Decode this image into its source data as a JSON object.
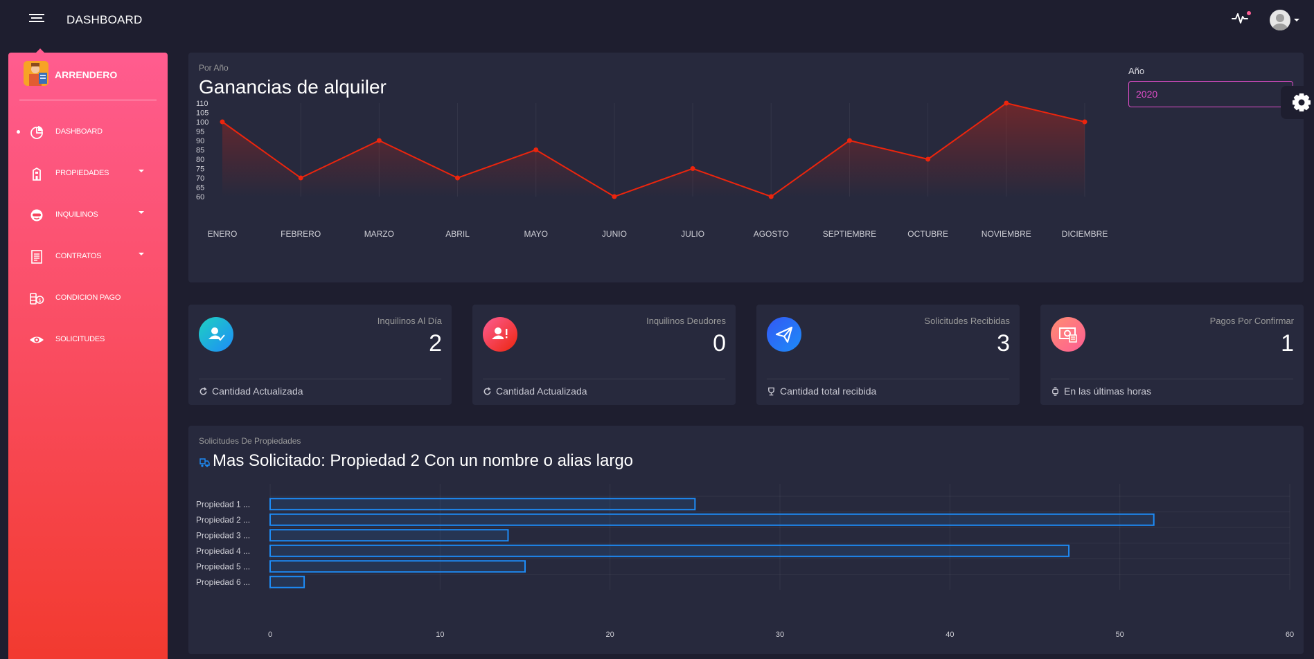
{
  "header": {
    "title": "DASHBOARD"
  },
  "sidebar": {
    "brand": "ARRENDERO",
    "items": [
      {
        "label": "DASHBOARD",
        "icon": "chart-pie-icon",
        "active": true,
        "has_dropdown": false
      },
      {
        "label": "PROPIEDADES",
        "icon": "building-icon",
        "active": false,
        "has_dropdown": true
      },
      {
        "label": "INQUILINOS",
        "icon": "user-mask-icon",
        "active": false,
        "has_dropdown": true
      },
      {
        "label": "CONTRATOS",
        "icon": "document-icon",
        "active": false,
        "has_dropdown": true
      },
      {
        "label": "CONDICION PAGO",
        "icon": "money-stack-icon",
        "active": false,
        "has_dropdown": false
      },
      {
        "label": "SOLICITUDES",
        "icon": "eye-icon",
        "active": false,
        "has_dropdown": false
      }
    ]
  },
  "earnings": {
    "category": "Por Año",
    "title": "Ganancias de alquiler",
    "year_label": "Año",
    "year_selected": "2020"
  },
  "stats": [
    {
      "label": "Inquilinos Al Día",
      "value": "2",
      "footer": "Cantidad Actualizada",
      "icon": "user-check-icon",
      "footer_icon": "refresh-icon",
      "color_from": "#1fd1c1",
      "color_to": "#1d8cf8"
    },
    {
      "label": "Inquilinos Deudores",
      "value": "0",
      "footer": "Cantidad Actualizada",
      "icon": "user-alert-icon",
      "footer_icon": "refresh-icon",
      "color_from": "#fd5d93",
      "color_to": "#ec250d"
    },
    {
      "label": "Solicitudes Recibidas",
      "value": "3",
      "footer": "Cantidad total recibida",
      "icon": "paper-plane-icon",
      "footer_icon": "trophy-icon",
      "color_from": "#3358f4",
      "color_to": "#1d8cf8"
    },
    {
      "label": "Pagos Por Confirmar",
      "value": "1",
      "footer": "En las últimas horas",
      "icon": "money-icon",
      "footer_icon": "watch-icon",
      "color_from": "#ff8d72",
      "color_to": "#fd5d93"
    }
  ],
  "requests": {
    "category": "Solicitudes De Propiedades",
    "title": "Mas Solicitado: Propiedad 2 Con un nombre o alias largo"
  },
  "chart_data": [
    {
      "type": "area",
      "categories": [
        "ENERO",
        "FEBRERO",
        "MARZO",
        "ABRIL",
        "MAYO",
        "JUNIO",
        "JULIO",
        "AGOSTO",
        "SEPTIEMBRE",
        "OCTUBRE",
        "NOVIEMBRE",
        "DICIEMBRE"
      ],
      "values": [
        100,
        70,
        90,
        70,
        85,
        60,
        75,
        60,
        90,
        80,
        110,
        100
      ],
      "yticks": [
        60,
        65,
        70,
        75,
        80,
        85,
        90,
        95,
        100,
        105,
        110
      ],
      "ylim": [
        60,
        110
      ],
      "color": "#ec250d",
      "grid": "vertical"
    },
    {
      "type": "bar",
      "orientation": "horizontal",
      "categories": [
        "Propiedad 1 ...",
        "Propiedad 2 ...",
        "Propiedad 3 ...",
        "Propiedad 4 ...",
        "Propiedad 5 ...",
        "Propiedad 6 ..."
      ],
      "values": [
        25,
        52,
        14,
        47,
        15,
        2
      ],
      "xticks": [
        0,
        10,
        20,
        30,
        40,
        50,
        60
      ],
      "xlim": [
        0,
        60
      ],
      "color": "#1d8cf8",
      "grid": true
    }
  ]
}
